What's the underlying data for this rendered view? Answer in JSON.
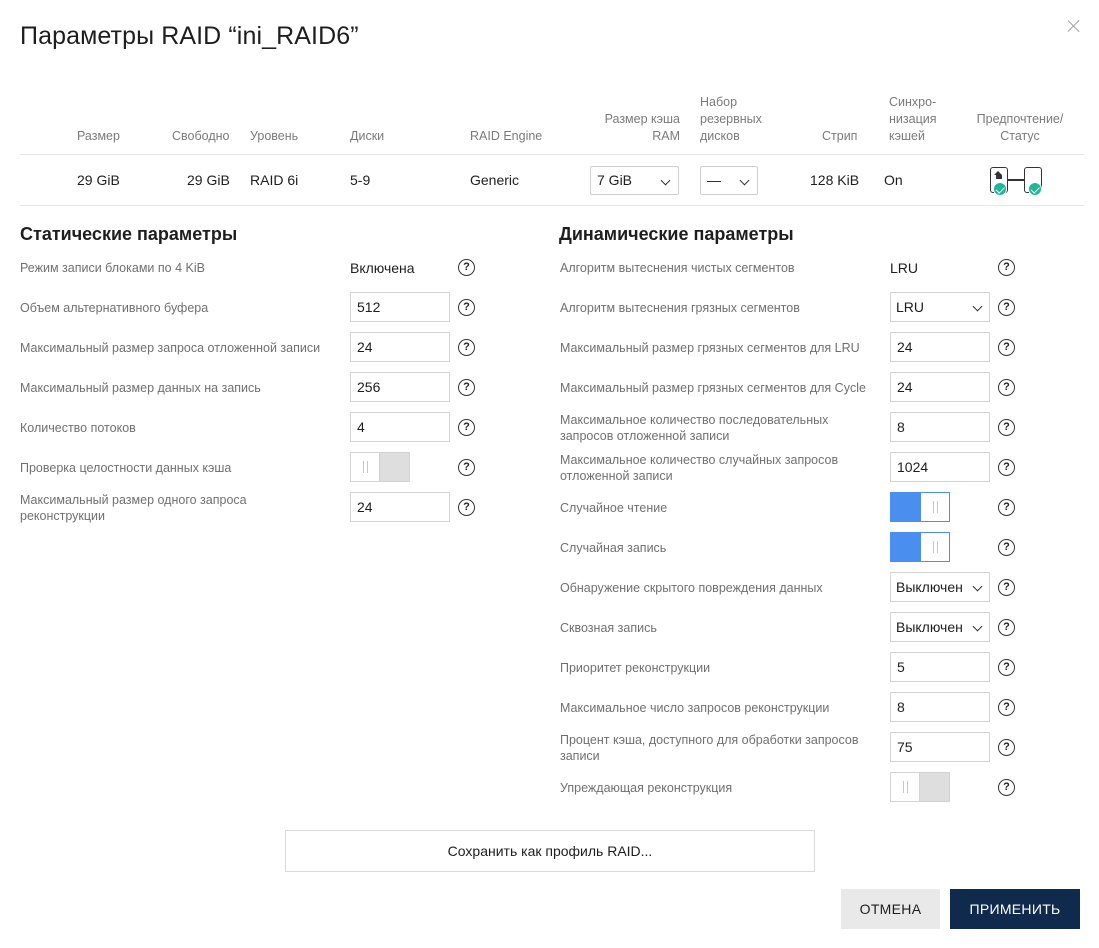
{
  "dialog": {
    "title": "Параметры RAID “ini_RAID6”",
    "close_icon": "close-icon"
  },
  "table": {
    "headers": {
      "size": "Размер",
      "free": "Свободно",
      "level": "Уровень",
      "disks": "Диски",
      "engine": "RAID Engine",
      "cache_ram": "Размер кэша RAM",
      "spare": "Набор резервных дисков",
      "strip": "Стрип",
      "sync": "Синхро-низация кэшей",
      "status": "Предпочтение/Статус"
    },
    "row": {
      "size": "29 GiB",
      "free": "29 GiB",
      "level": "RAID 6i",
      "disks": "5-9",
      "engine": "Generic",
      "cache_ram": "7 GiB",
      "spare": "—",
      "strip": "128 KiB",
      "sync": "On"
    },
    "status_icons": [
      "preferred-disk-icon",
      "check-icon",
      "disk-icon",
      "check-icon"
    ],
    "status_color": "#1fb894"
  },
  "static": {
    "title": "Статические параметры",
    "params": [
      {
        "label": "Режим записи блоками по 4 KiB",
        "value": "Включена"
      },
      {
        "label": "Объем альтернативного буфера",
        "value": "512"
      },
      {
        "label": "Максимальный размер запроса отложенной записи",
        "value": "24"
      },
      {
        "label": "Максимальный размер данных на запись",
        "value": "256"
      },
      {
        "label": "Количество потоков",
        "value": "4"
      },
      {
        "label": "Проверка целостности данных кэша",
        "value": "off"
      },
      {
        "label": "Максимальный размер одного запроса реконструкции",
        "value": "24"
      }
    ]
  },
  "dynamic": {
    "title": "Динамические параметры",
    "params": [
      {
        "label": "Алгоритм вытеснения чистых сегментов",
        "value": "LRU"
      },
      {
        "label": "Алгоритм вытеснения грязных сегментов",
        "value": "LRU"
      },
      {
        "label": "Максимальный размер грязных сегментов для LRU",
        "value": "24"
      },
      {
        "label": "Максимальный размер грязных сегментов для Cycle",
        "value": "24"
      },
      {
        "label": "Максимальное количество последовательных запросов отложенной записи",
        "value": "8"
      },
      {
        "label": "Максимальное количество случайных запросов отложенной записи",
        "value": "1024"
      },
      {
        "label": "Случайное чтение",
        "value": "on"
      },
      {
        "label": "Случайная запись",
        "value": "on"
      },
      {
        "label": "Обнаружение скрытого повреждения данных",
        "value": "Выключен"
      },
      {
        "label": "Сквозная запись",
        "value": "Выключен"
      },
      {
        "label": "Приоритет реконструкции",
        "value": "5"
      },
      {
        "label": "Максимальное число запросов реконструкции",
        "value": "8"
      },
      {
        "label": "Процент кэша, доступного для обработки запросов записи",
        "value": "75"
      },
      {
        "label": "Упреждающая реконструкция",
        "value": "off"
      }
    ]
  },
  "help_icon": "question-circle-icon",
  "help_glyph": "?",
  "buttons": {
    "save_profile": "Сохранить как профиль RAID...",
    "cancel": "ОТМЕНА",
    "apply": "ПРИМЕНИТЬ"
  },
  "colors": {
    "accent": "#4a8ef0",
    "primary_button": "#102a4d"
  }
}
